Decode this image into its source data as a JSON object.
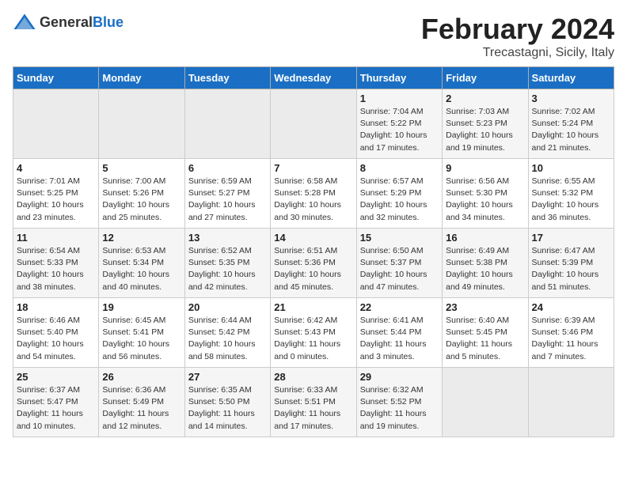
{
  "header": {
    "logo_general": "General",
    "logo_blue": "Blue",
    "month": "February 2024",
    "location": "Trecastagni, Sicily, Italy"
  },
  "weekdays": [
    "Sunday",
    "Monday",
    "Tuesday",
    "Wednesday",
    "Thursday",
    "Friday",
    "Saturday"
  ],
  "weeks": [
    [
      {
        "day": "",
        "empty": true
      },
      {
        "day": "",
        "empty": true
      },
      {
        "day": "",
        "empty": true
      },
      {
        "day": "",
        "empty": true
      },
      {
        "day": "1",
        "sunrise": "7:04 AM",
        "sunset": "5:22 PM",
        "daylight": "10 hours and 17 minutes."
      },
      {
        "day": "2",
        "sunrise": "7:03 AM",
        "sunset": "5:23 PM",
        "daylight": "10 hours and 19 minutes."
      },
      {
        "day": "3",
        "sunrise": "7:02 AM",
        "sunset": "5:24 PM",
        "daylight": "10 hours and 21 minutes."
      }
    ],
    [
      {
        "day": "4",
        "sunrise": "7:01 AM",
        "sunset": "5:25 PM",
        "daylight": "10 hours and 23 minutes."
      },
      {
        "day": "5",
        "sunrise": "7:00 AM",
        "sunset": "5:26 PM",
        "daylight": "10 hours and 25 minutes."
      },
      {
        "day": "6",
        "sunrise": "6:59 AM",
        "sunset": "5:27 PM",
        "daylight": "10 hours and 27 minutes."
      },
      {
        "day": "7",
        "sunrise": "6:58 AM",
        "sunset": "5:28 PM",
        "daylight": "10 hours and 30 minutes."
      },
      {
        "day": "8",
        "sunrise": "6:57 AM",
        "sunset": "5:29 PM",
        "daylight": "10 hours and 32 minutes."
      },
      {
        "day": "9",
        "sunrise": "6:56 AM",
        "sunset": "5:30 PM",
        "daylight": "10 hours and 34 minutes."
      },
      {
        "day": "10",
        "sunrise": "6:55 AM",
        "sunset": "5:32 PM",
        "daylight": "10 hours and 36 minutes."
      }
    ],
    [
      {
        "day": "11",
        "sunrise": "6:54 AM",
        "sunset": "5:33 PM",
        "daylight": "10 hours and 38 minutes."
      },
      {
        "day": "12",
        "sunrise": "6:53 AM",
        "sunset": "5:34 PM",
        "daylight": "10 hours and 40 minutes."
      },
      {
        "day": "13",
        "sunrise": "6:52 AM",
        "sunset": "5:35 PM",
        "daylight": "10 hours and 42 minutes."
      },
      {
        "day": "14",
        "sunrise": "6:51 AM",
        "sunset": "5:36 PM",
        "daylight": "10 hours and 45 minutes."
      },
      {
        "day": "15",
        "sunrise": "6:50 AM",
        "sunset": "5:37 PM",
        "daylight": "10 hours and 47 minutes."
      },
      {
        "day": "16",
        "sunrise": "6:49 AM",
        "sunset": "5:38 PM",
        "daylight": "10 hours and 49 minutes."
      },
      {
        "day": "17",
        "sunrise": "6:47 AM",
        "sunset": "5:39 PM",
        "daylight": "10 hours and 51 minutes."
      }
    ],
    [
      {
        "day": "18",
        "sunrise": "6:46 AM",
        "sunset": "5:40 PM",
        "daylight": "10 hours and 54 minutes."
      },
      {
        "day": "19",
        "sunrise": "6:45 AM",
        "sunset": "5:41 PM",
        "daylight": "10 hours and 56 minutes."
      },
      {
        "day": "20",
        "sunrise": "6:44 AM",
        "sunset": "5:42 PM",
        "daylight": "10 hours and 58 minutes."
      },
      {
        "day": "21",
        "sunrise": "6:42 AM",
        "sunset": "5:43 PM",
        "daylight": "11 hours and 0 minutes."
      },
      {
        "day": "22",
        "sunrise": "6:41 AM",
        "sunset": "5:44 PM",
        "daylight": "11 hours and 3 minutes."
      },
      {
        "day": "23",
        "sunrise": "6:40 AM",
        "sunset": "5:45 PM",
        "daylight": "11 hours and 5 minutes."
      },
      {
        "day": "24",
        "sunrise": "6:39 AM",
        "sunset": "5:46 PM",
        "daylight": "11 hours and 7 minutes."
      }
    ],
    [
      {
        "day": "25",
        "sunrise": "6:37 AM",
        "sunset": "5:47 PM",
        "daylight": "11 hours and 10 minutes."
      },
      {
        "day": "26",
        "sunrise": "6:36 AM",
        "sunset": "5:49 PM",
        "daylight": "11 hours and 12 minutes."
      },
      {
        "day": "27",
        "sunrise": "6:35 AM",
        "sunset": "5:50 PM",
        "daylight": "11 hours and 14 minutes."
      },
      {
        "day": "28",
        "sunrise": "6:33 AM",
        "sunset": "5:51 PM",
        "daylight": "11 hours and 17 minutes."
      },
      {
        "day": "29",
        "sunrise": "6:32 AM",
        "sunset": "5:52 PM",
        "daylight": "11 hours and 19 minutes."
      },
      {
        "day": "",
        "empty": true
      },
      {
        "day": "",
        "empty": true
      }
    ]
  ]
}
